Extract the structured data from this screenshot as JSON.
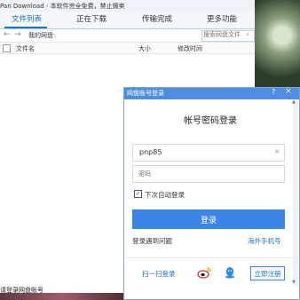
{
  "window": {
    "title": "Pan Download - 本软件完全免费，禁止贩卖"
  },
  "tabs": [
    {
      "label": "文件列表"
    },
    {
      "label": "正在下载"
    },
    {
      "label": "传输完成"
    },
    {
      "label": "更多功能"
    }
  ],
  "address": {
    "path_label": "我的网盘:",
    "search_placeholder": "搜索网盘文件",
    "back": "←",
    "forward": "→"
  },
  "columns": {
    "name": "文件名",
    "size": "大小",
    "time": "修改时间"
  },
  "status": {
    "text": "请登录网盘账号"
  },
  "login_dialog": {
    "title": "网盘账号登录",
    "help": "?",
    "close": "×",
    "heading": "帐号密码登录",
    "username": "pnp85",
    "clear": "×",
    "password_placeholder": "密码",
    "auto_login_label": "下次自动登录",
    "auto_login_checked": "✓",
    "login_button": "登录",
    "problem_link": "登录遇到问题",
    "overseas_link": "海外手机号",
    "qr_link": "扫一扫登录",
    "register_button": "立即注册"
  },
  "colors": {
    "accent": "#3a86e8",
    "title_bar": "#4d8ee0"
  }
}
